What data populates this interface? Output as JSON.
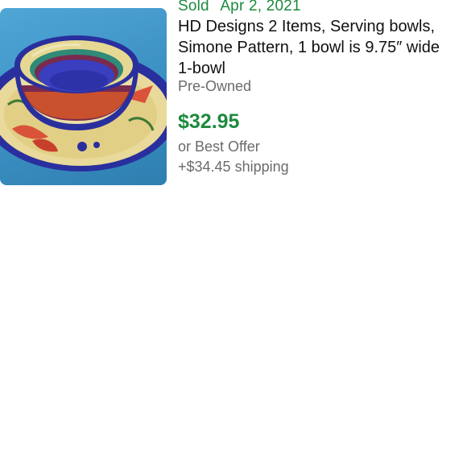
{
  "listing": {
    "image_alt_icon": "bowl-photo",
    "sold_label": "Sold",
    "sold_date": "Apr 2, 2021",
    "title_lines": [
      "HD Designs 2 Items, Serving bowls,",
      "Simone Pattern, 1 bowl is 9.75″ wide",
      "1-bowl"
    ],
    "condition": "Pre-Owned",
    "price": "$32.95",
    "offer": "or Best Offer",
    "shipping": "+$34.45 shipping"
  },
  "colors": {
    "sold_green": "#1e8a3e",
    "price_green": "#1e8a3e",
    "muted_text": "#6b6b6b",
    "title_text": "#111111"
  }
}
